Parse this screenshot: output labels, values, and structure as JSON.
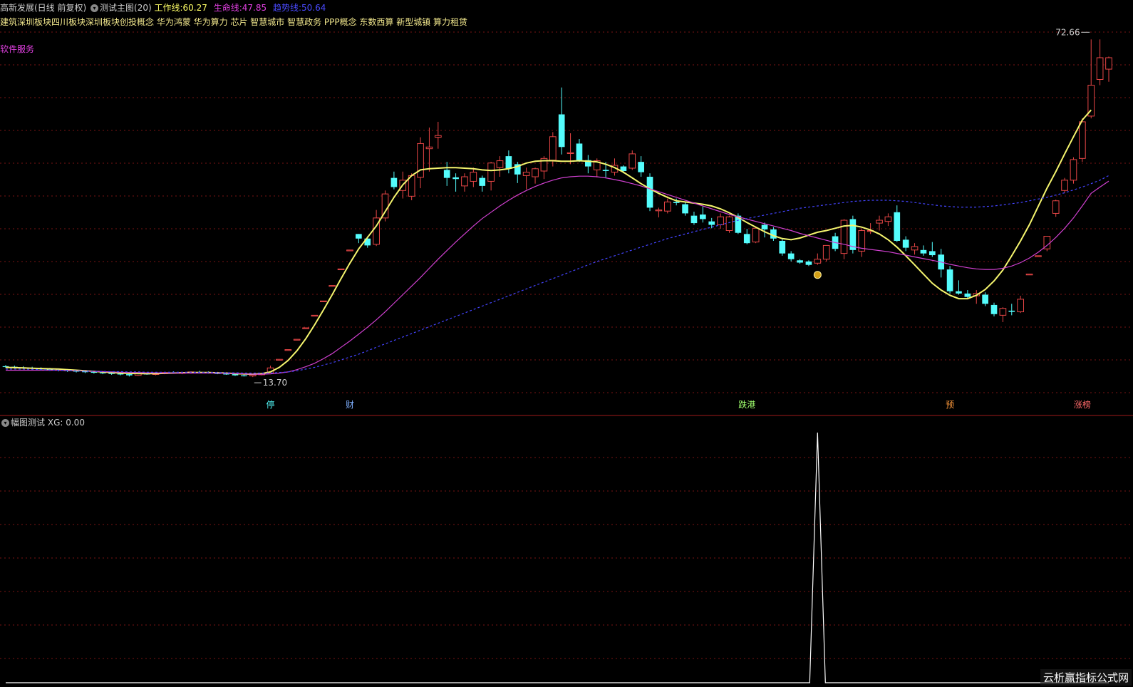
{
  "header": {
    "stock_name": "高新发展(日线 前复权)",
    "indicator_name": "测试主图(20)",
    "work_line_label": "工作线:",
    "work_line_value": "60.27",
    "life_line_label": "生命线:",
    "life_line_value": "47.85",
    "trend_line_label": "趋势线:",
    "trend_line_value": "50.64",
    "concepts": "建筑深圳板块四川板块深圳板块创投概念 华为鸿蒙 华为算力 芯片 智慧城市 智慧政务 PPP概念 东数西算 新型城镇 算力租赁",
    "software_label": "软件服务"
  },
  "sub_header": {
    "name": "幅图测试",
    "xg_label": "XG:",
    "xg_value": "0.00"
  },
  "watermark": "云析赢指标公式网",
  "colors": {
    "up": "#e84646",
    "down": "#54fcfc",
    "work_line": "#f5f56e",
    "life_line": "#d040d0",
    "trend_line": "#4444ff",
    "grid": "#7a1515",
    "work_text": "#ffff66",
    "life_text": "#e040e0",
    "trend_text": "#4a4aff"
  },
  "chart_data": [
    {
      "type": "candlestick",
      "panel": "main",
      "yrange": [
        10.5,
        75.5
      ],
      "candles": [
        [
          15.5,
          15.7,
          15.2,
          15.4
        ],
        [
          15.4,
          15.6,
          15.1,
          15.3
        ],
        [
          15.3,
          15.5,
          15.0,
          15.2
        ],
        [
          15.2,
          15.4,
          14.9,
          15.1
        ],
        [
          15.1,
          15.3,
          14.8,
          15.0
        ],
        [
          15.0,
          15.2,
          14.7,
          14.9
        ],
        [
          14.9,
          15.1,
          14.6,
          14.8
        ],
        [
          14.8,
          15.0,
          14.5,
          14.7
        ],
        [
          14.7,
          14.9,
          14.4,
          14.6
        ],
        [
          14.6,
          14.8,
          14.3,
          14.5
        ],
        [
          14.5,
          14.7,
          14.2,
          14.4
        ],
        [
          14.4,
          14.6,
          14.1,
          14.3
        ],
        [
          14.3,
          14.5,
          14.0,
          14.2
        ],
        [
          14.2,
          14.4,
          13.9,
          14.1
        ],
        [
          14.1,
          14.4,
          13.7,
          13.9
        ],
        [
          13.9,
          14.3,
          13.8,
          14.2
        ],
        [
          14.2,
          14.4,
          14.0,
          14.1
        ],
        [
          14.1,
          14.3,
          13.9,
          14.2
        ],
        [
          14.2,
          14.5,
          14.1,
          14.4
        ],
        [
          14.4,
          14.6,
          14.2,
          14.3
        ],
        [
          14.3,
          14.5,
          14.1,
          14.4
        ],
        [
          14.4,
          14.6,
          14.2,
          14.5
        ],
        [
          14.5,
          14.7,
          14.3,
          14.4
        ],
        [
          14.4,
          14.6,
          14.2,
          14.3
        ],
        [
          14.3,
          14.5,
          14.1,
          14.2
        ],
        [
          14.2,
          14.4,
          14.0,
          14.1
        ],
        [
          14.1,
          14.3,
          13.8,
          13.9
        ],
        [
          13.9,
          14.1,
          13.7,
          13.8
        ],
        [
          13.8,
          14.1,
          13.6,
          14.0
        ],
        [
          14.0,
          14.3,
          13.9,
          14.2
        ],
        [
          14.2,
          15.6,
          14.1,
          15.2
        ],
        [
          16.7,
          16.7,
          16.7,
          16.7
        ],
        [
          18.4,
          18.4,
          18.4,
          18.4
        ],
        [
          20.2,
          20.2,
          20.2,
          20.2
        ],
        [
          22.2,
          22.2,
          22.2,
          22.2
        ],
        [
          24.4,
          24.4,
          24.4,
          24.4
        ],
        [
          26.9,
          26.9,
          26.9,
          26.9
        ],
        [
          29.6,
          29.6,
          29.6,
          29.6
        ],
        [
          32.5,
          32.5,
          32.5,
          32.5
        ],
        [
          35.8,
          35.8,
          35.8,
          35.8
        ],
        [
          38.6,
          38.6,
          37.0,
          37.8
        ],
        [
          37.8,
          38.2,
          36.2,
          36.6
        ],
        [
          36.8,
          42.8,
          36.5,
          41.4
        ],
        [
          41.4,
          46.2,
          40.8,
          45.6
        ],
        [
          48.4,
          49.5,
          46.4,
          46.8
        ],
        [
          46.2,
          49.5,
          44.8,
          48.0
        ],
        [
          45.2,
          49.2,
          44.5,
          48.8
        ],
        [
          48.5,
          55.5,
          46.6,
          54.4
        ],
        [
          53.5,
          57.2,
          49.5,
          53.8
        ],
        [
          55.5,
          58.2,
          53.5,
          55.8
        ],
        [
          49.8,
          51.2,
          47.0,
          48.4
        ],
        [
          48.5,
          49.2,
          46.0,
          48.2
        ],
        [
          47.0,
          49.2,
          46.0,
          48.6
        ],
        [
          47.8,
          50.2,
          46.8,
          49.4
        ],
        [
          48.4,
          48.8,
          46.0,
          47.0
        ],
        [
          47.8,
          51.2,
          46.2,
          51.0
        ],
        [
          50.2,
          52.2,
          48.6,
          51.4
        ],
        [
          52.2,
          53.2,
          49.2,
          50.0
        ],
        [
          50.8,
          51.2,
          47.5,
          49.0
        ],
        [
          48.8,
          50.2,
          46.4,
          49.4
        ],
        [
          48.6,
          50.2,
          47.4,
          50.0
        ],
        [
          49.6,
          52.2,
          48.2,
          51.8
        ],
        [
          51.5,
          56.4,
          50.4,
          55.6
        ],
        [
          59.5,
          64.2,
          52.5,
          53.8
        ],
        [
          52.8,
          56.2,
          50.8,
          52.8
        ],
        [
          54.4,
          55.2,
          51.2,
          51.5
        ],
        [
          51.5,
          52.4,
          49.2,
          50.4
        ],
        [
          49.8,
          51.8,
          48.5,
          51.4
        ],
        [
          49.8,
          51.2,
          48.5,
          49.6
        ],
        [
          49.4,
          51.8,
          48.8,
          50.6
        ],
        [
          50.4,
          50.6,
          49.2,
          49.6
        ],
        [
          50.1,
          53.2,
          49.8,
          52.6
        ],
        [
          51.2,
          52.2,
          48.6,
          49.4
        ],
        [
          48.6,
          49.2,
          42.6,
          43.2
        ],
        [
          42.8,
          43.2,
          41.5,
          42.8
        ],
        [
          42.6,
          44.8,
          42.2,
          44.2
        ],
        [
          44.2,
          44.8,
          43.6,
          44.0
        ],
        [
          43.8,
          44.2,
          41.8,
          42.2
        ],
        [
          41.8,
          42.5,
          40.2,
          40.5
        ],
        [
          42.0,
          43.4,
          40.6,
          41.2
        ],
        [
          40.8,
          41.4,
          39.6,
          40.2
        ],
        [
          40.2,
          42.2,
          39.5,
          41.6
        ],
        [
          39.2,
          41.8,
          38.8,
          41.6
        ],
        [
          41.8,
          42.2,
          38.6,
          38.8
        ],
        [
          38.6,
          39.5,
          36.8,
          37.0
        ],
        [
          37.2,
          39.8,
          37.0,
          39.6
        ],
        [
          40.2,
          40.6,
          38.0,
          39.4
        ],
        [
          39.4,
          39.8,
          37.4,
          37.8
        ],
        [
          37.4,
          37.8,
          34.8,
          35.2
        ],
        [
          35.2,
          35.6,
          33.8,
          34.2
        ],
        [
          34.0,
          34.2,
          33.4,
          33.6
        ],
        [
          33.8,
          34.0,
          33.0,
          33.2
        ],
        [
          33.5,
          35.2,
          33.2,
          34.2
        ],
        [
          34.2,
          36.6,
          33.8,
          36.6
        ],
        [
          38.2,
          38.8,
          35.6,
          36.0
        ],
        [
          35.2,
          41.2,
          34.2,
          41.0
        ],
        [
          41.2,
          41.8,
          35.2,
          35.8
        ],
        [
          35.6,
          39.6,
          34.6,
          39.2
        ],
        [
          39.2,
          40.5,
          38.6,
          39.2
        ],
        [
          40.5,
          41.8,
          39.2,
          41.0
        ],
        [
          40.8,
          42.2,
          40.0,
          41.6
        ],
        [
          42.4,
          43.6,
          37.2,
          37.4
        ],
        [
          37.6,
          38.2,
          35.6,
          36.2
        ],
        [
          35.8,
          37.0,
          35.0,
          36.4
        ],
        [
          35.8,
          36.6,
          34.8,
          35.2
        ],
        [
          35.6,
          37.2,
          34.6,
          34.9
        ],
        [
          35.0,
          36.0,
          31.0,
          32.4
        ],
        [
          32.4,
          33.0,
          28.2,
          28.6
        ],
        [
          28.6,
          30.5,
          28.0,
          28.2
        ],
        [
          28.2,
          28.8,
          27.4,
          27.6
        ],
        [
          27.8,
          28.8,
          26.4,
          28.2
        ],
        [
          28.0,
          28.4,
          26.0,
          26.4
        ],
        [
          26.2,
          26.6,
          24.2,
          24.6
        ],
        [
          24.4,
          25.8,
          23.2,
          25.6
        ],
        [
          25.2,
          26.4,
          24.4,
          25.0
        ],
        [
          25.0,
          27.8,
          24.8,
          27.2
        ],
        [
          31.6,
          31.6,
          31.6,
          31.6
        ],
        [
          34.8,
          34.8,
          34.8,
          34.8
        ],
        [
          36.0,
          38.2,
          35.6,
          38.2
        ],
        [
          42.2,
          44.6,
          41.6,
          44.4
        ],
        [
          46.2,
          48.4,
          45.8,
          48.0
        ],
        [
          48.0,
          52.0,
          47.4,
          51.6
        ],
        [
          51.8,
          58.8,
          51.2,
          58.2
        ],
        [
          59.2,
          72.6,
          58.8,
          64.6
        ],
        [
          65.6,
          72.6,
          64.6,
          69.4
        ],
        [
          67.4,
          69.6,
          65.2,
          69.4
        ]
      ],
      "lines": [
        {
          "name": "工作线",
          "value": 60.27,
          "values": [
            15.3,
            15.25,
            15.2,
            15.15,
            15.1,
            15.05,
            15.0,
            14.9,
            14.8,
            14.7,
            14.6,
            14.5,
            14.4,
            14.3,
            14.25,
            14.2,
            14.2,
            14.2,
            14.25,
            14.3,
            14.35,
            14.4,
            14.4,
            14.4,
            14.35,
            14.3,
            14.2,
            14.15,
            14.1,
            14.2,
            14.5,
            15.3,
            16.5,
            18.2,
            20.3,
            22.7,
            25.3,
            28.0,
            30.8,
            33.5,
            36.0,
            38.0,
            40.0,
            42.5,
            45.0,
            47.2,
            48.8,
            49.8,
            50.0,
            50.1,
            50.2,
            50.2,
            50.1,
            50.0,
            49.8,
            49.7,
            49.8,
            50.0,
            50.4,
            51.0,
            51.3,
            51.4,
            51.4,
            51.3,
            51.3,
            51.4,
            51.3,
            51.2,
            50.8,
            50.2,
            49.4,
            48.4,
            47.4,
            46.5,
            45.7,
            45.0,
            44.4,
            44.2,
            44.0,
            43.8,
            43.5,
            43.0,
            42.3,
            41.5,
            40.6,
            39.8,
            39.0,
            38.3,
            37.8,
            37.6,
            37.9,
            38.4,
            38.9,
            39.2,
            39.6,
            40.0,
            40.1,
            39.8,
            39.3,
            38.6,
            37.6,
            36.3,
            34.8,
            33.2,
            31.6,
            30.0,
            28.8,
            27.9,
            27.3,
            27.3,
            27.9,
            28.9,
            30.4,
            32.3,
            34.8,
            37.4,
            40.2,
            43.4,
            46.6,
            49.5,
            52.6,
            55.6,
            58.5,
            60.27
          ]
        },
        {
          "name": "生命线",
          "value": 47.85,
          "values": [
            14.8,
            14.8,
            14.8,
            14.8,
            14.8,
            14.8,
            14.8,
            14.75,
            14.7,
            14.65,
            14.6,
            14.55,
            14.5,
            14.45,
            14.4,
            14.4,
            14.35,
            14.35,
            14.3,
            14.3,
            14.3,
            14.3,
            14.3,
            14.3,
            14.3,
            14.25,
            14.2,
            14.15,
            14.1,
            14.1,
            14.15,
            14.3,
            14.5,
            14.9,
            15.4,
            16.0,
            16.8,
            17.7,
            18.8,
            19.9,
            21.1,
            22.3,
            23.6,
            25.0,
            26.5,
            28.0,
            29.5,
            31.0,
            32.6,
            34.2,
            35.7,
            37.2,
            38.6,
            40.0,
            41.3,
            42.4,
            43.5,
            44.5,
            45.4,
            46.2,
            46.9,
            47.5,
            48.0,
            48.4,
            48.6,
            48.7,
            48.7,
            48.6,
            48.4,
            48.1,
            47.8,
            47.4,
            47.0,
            46.5,
            46.0,
            45.5,
            45.0,
            44.5,
            44.0,
            43.5,
            43.0,
            42.5,
            42.0,
            41.6,
            41.2,
            40.8,
            40.4,
            40.0,
            39.6,
            39.2,
            38.7,
            38.3,
            37.9,
            37.5,
            37.1,
            36.8,
            36.4,
            36.1,
            35.9,
            35.7,
            35.5,
            35.2,
            34.9,
            34.6,
            34.3,
            34.0,
            33.7,
            33.3,
            33.0,
            32.7,
            32.5,
            32.4,
            32.4,
            32.6,
            33.0,
            33.6,
            34.4,
            35.4,
            36.6,
            38.0,
            39.6,
            41.4,
            43.5,
            45.7,
            46.8,
            47.85
          ]
        },
        {
          "name": "趋势线",
          "value": 50.64,
          "values": [
            15.0,
            15.0,
            15.0,
            14.95,
            14.9,
            14.85,
            14.8,
            14.75,
            14.7,
            14.65,
            14.6,
            14.6,
            14.55,
            14.55,
            14.5,
            14.5,
            14.45,
            14.45,
            14.45,
            14.45,
            14.45,
            14.45,
            14.4,
            14.4,
            14.4,
            14.35,
            14.35,
            14.3,
            14.3,
            14.3,
            14.3,
            14.4,
            14.5,
            14.7,
            15.0,
            15.3,
            15.7,
            16.1,
            16.6,
            17.1,
            17.6,
            18.2,
            18.8,
            19.4,
            20.0,
            20.6,
            21.2,
            21.8,
            22.4,
            23.0,
            23.6,
            24.2,
            24.8,
            25.4,
            26.0,
            26.6,
            27.2,
            27.8,
            28.4,
            29.0,
            29.6,
            30.2,
            30.8,
            31.4,
            32.0,
            32.6,
            33.2,
            33.8,
            34.3,
            34.8,
            35.3,
            35.8,
            36.3,
            36.8,
            37.3,
            37.8,
            38.2,
            38.6,
            39.0,
            39.4,
            39.8,
            40.2,
            40.6,
            41.0,
            41.3,
            41.6,
            41.9,
            42.2,
            42.5,
            42.8,
            43.1,
            43.3,
            43.5,
            43.7,
            43.9,
            44.1,
            44.3,
            44.4,
            44.5,
            44.5,
            44.5,
            44.4,
            44.3,
            44.1,
            43.9,
            43.7,
            43.5,
            43.4,
            43.3,
            43.3,
            43.3,
            43.4,
            43.5,
            43.7,
            43.9,
            44.1,
            44.4,
            44.7,
            45.0,
            45.4,
            45.8,
            46.3,
            46.8,
            47.4,
            48.0,
            48.8
          ]
        }
      ],
      "annotations": [
        {
          "text": "13.70",
          "type": "low"
        },
        {
          "text": "72.66",
          "type": "high"
        }
      ],
      "bottom_markers": [
        {
          "text": "停",
          "index": 30,
          "color": "#54fcfc"
        },
        {
          "text": "财",
          "index": 39,
          "color": "#7fb0ff"
        },
        {
          "text": "跌港",
          "index": 84,
          "color": "#a0ff6e"
        },
        {
          "text": "预",
          "index": 107,
          "color": "#ff9a3c"
        },
        {
          "text": "涨榜",
          "index": 122,
          "color": "#ff6a6a"
        }
      ]
    },
    {
      "type": "line",
      "panel": "sub",
      "yrange": [
        0,
        1
      ],
      "series": [
        {
          "name": "XG",
          "values_spike_index": 92,
          "spike_value": 1,
          "baseline": 0
        }
      ]
    }
  ]
}
